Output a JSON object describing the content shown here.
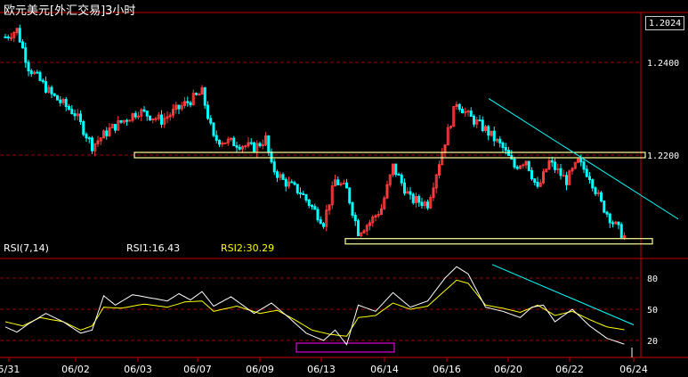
{
  "title": "欧元美元[外汇交易]3小时",
  "current_price": "1.2024",
  "colors": {
    "background": "#000000",
    "bull_candle": "#ff3b3b",
    "bear_candle": "#00ffff",
    "grid": "#a00000",
    "rsi1_line": "#ffffff",
    "rsi2_line": "#ffff00",
    "trendline": "#00ffff",
    "support_box": "#ffff99",
    "rsi_box": "#ff00ff",
    "axis_text": "#ffffff"
  },
  "rsi_labels": {
    "name": "RSI(7,14)",
    "rsi1": "RSI1:16.43",
    "rsi2": "RSI2:30.29"
  },
  "chart_data": [
    {
      "type": "candlestick",
      "ylim": [
        1.2,
        1.25
      ],
      "y_ticks": [
        "1.2400",
        "1.2200"
      ],
      "x_ticks": [
        "5/31",
        "06/02",
        "06/03",
        "06/07",
        "06/09",
        "06/13",
        "06/14",
        "06/16",
        "06/20",
        "06/22",
        "06/24"
      ],
      "key_prices": {
        "open": 1.2455,
        "high": 1.2475,
        "low": 1.201,
        "last": 1.2024
      },
      "annotations": [
        {
          "kind": "horizontal-box",
          "level": 1.22,
          "from": "06/03",
          "to": "06/24"
        },
        {
          "kind": "horizontal-box",
          "level": 1.2014,
          "from": "06/13",
          "to": "06/24"
        },
        {
          "kind": "downtrend-line",
          "from_price": 1.2322,
          "to_price": 1.2062
        }
      ]
    },
    {
      "type": "line",
      "ylim": [
        0,
        100
      ],
      "y_ticks": [
        "80",
        "50",
        "20"
      ],
      "series": [
        {
          "name": "RSI1",
          "last": 16.43
        },
        {
          "name": "RSI2",
          "last": 30.29
        }
      ],
      "annotations": [
        {
          "kind": "box",
          "around": "06/13"
        },
        {
          "kind": "downtrend-line",
          "from_value": 93,
          "to_value": 35
        }
      ]
    }
  ]
}
